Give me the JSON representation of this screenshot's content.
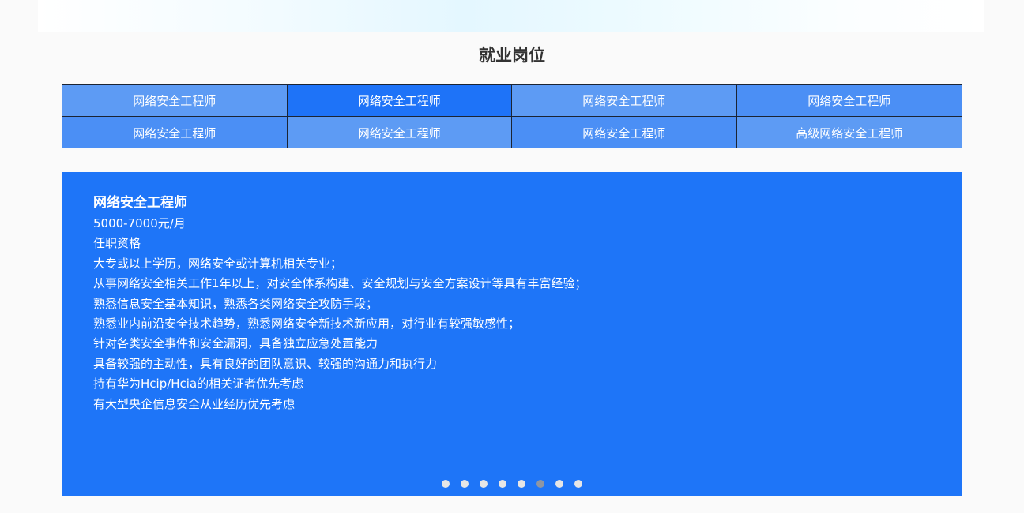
{
  "section": {
    "title": "就业岗位"
  },
  "tabs": [
    {
      "label": "网络安全工程师",
      "state": "light"
    },
    {
      "label": "网络安全工程师",
      "state": "active"
    },
    {
      "label": "网络安全工程师",
      "state": "light"
    },
    {
      "label": "网络安全工程师",
      "state": "mid"
    },
    {
      "label": "网络安全工程师",
      "state": "mid"
    },
    {
      "label": "网络安全工程师",
      "state": "light"
    },
    {
      "label": "网络安全工程师",
      "state": "mid"
    },
    {
      "label": "高级网络安全工程师",
      "state": "light"
    }
  ],
  "detail": {
    "title": "网络安全工程师",
    "salary": "5000-7000元/月",
    "requirements_heading": "任职资格",
    "requirements": [
      "大专或以上学历，网络安全或计算机相关专业；",
      "从事网络安全相关工作1年以上，对安全体系构建、安全规划与安全方案设计等具有丰富经验；",
      "熟悉信息安全基本知识，熟悉各类网络安全攻防手段；",
      "熟悉业内前沿安全技术趋势，熟悉网络安全新技术新应用，对行业有较强敏感性；",
      "针对各类安全事件和安全漏洞，具备独立应急处置能力",
      "具备较强的主动性，具有良好的团队意识、较强的沟通力和执行力",
      "持有华为Hcip/Hcia的相关证者优先考虑",
      "有大型央企信息安全从业经历优先考虑"
    ]
  },
  "carousel": {
    "dot_count": 8,
    "active_index": 5
  },
  "colors": {
    "panel_blue": "#1e75f8",
    "tab_active": "#1e73f8",
    "tab_light": "#5d9bf4",
    "tab_mid": "#4b8ff5",
    "title_text": "#333333"
  }
}
